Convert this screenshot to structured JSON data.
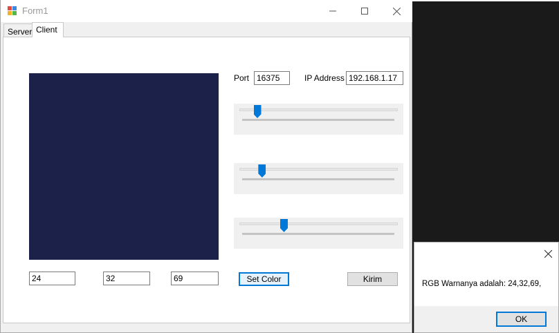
{
  "window": {
    "title": "Form1",
    "icon": "windows-forms-app-icon"
  },
  "tabs": [
    {
      "label": "Server",
      "selected": false
    },
    {
      "label": "Client",
      "selected": true
    }
  ],
  "client": {
    "preview_color": "#18204",
    "port_label": "Port",
    "port_value": "16375",
    "ip_label": "IP Address",
    "ip_value": "192.168.1.17",
    "red_value": "24",
    "green_value": "32",
    "blue_value": "69",
    "sliders": [
      {
        "name": "red",
        "value": 24,
        "max": 255
      },
      {
        "name": "green",
        "value": 32,
        "max": 255
      },
      {
        "name": "blue",
        "value": 69,
        "max": 255
      }
    ],
    "set_color_label": "Set Color",
    "send_label": "Kirim"
  },
  "message_box": {
    "text": "RGB Warnanya adalah: 24,32,69,",
    "ok_label": "OK"
  },
  "colors": {
    "preview": "#1b2148",
    "accent": "#0078d7",
    "window_bg": "#f0f0f0"
  }
}
